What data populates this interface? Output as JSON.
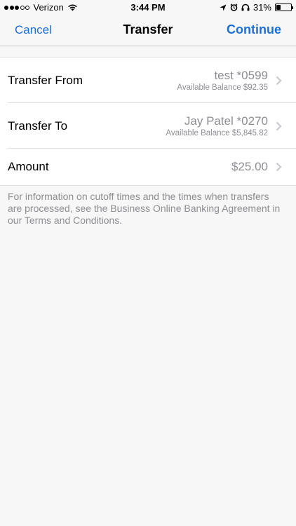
{
  "status_bar": {
    "carrier": "Verizon",
    "time": "3:44 PM",
    "battery_percent": "31%",
    "signal_bars_filled": 3,
    "signal_bars_total": 5,
    "battery_level": 0.31
  },
  "nav": {
    "cancel_label": "Cancel",
    "title": "Transfer",
    "continue_label": "Continue"
  },
  "rows": {
    "from": {
      "label": "Transfer From",
      "account": "test *0599",
      "balance": "Available Balance $92.35"
    },
    "to": {
      "label": "Transfer To",
      "account": "Jay Patel *0270",
      "balance": "Available Balance $5,845.82"
    },
    "amount": {
      "label": "Amount",
      "value": "$25.00"
    }
  },
  "footer": {
    "info": "For information on cutoff times and the times when transfers are processed, see the Business Online Banking Agreement in our Terms and Conditions."
  },
  "colors": {
    "accent": "#1d6fd8",
    "secondary_text": "#8e8e93",
    "background": "#f7f7f7"
  }
}
